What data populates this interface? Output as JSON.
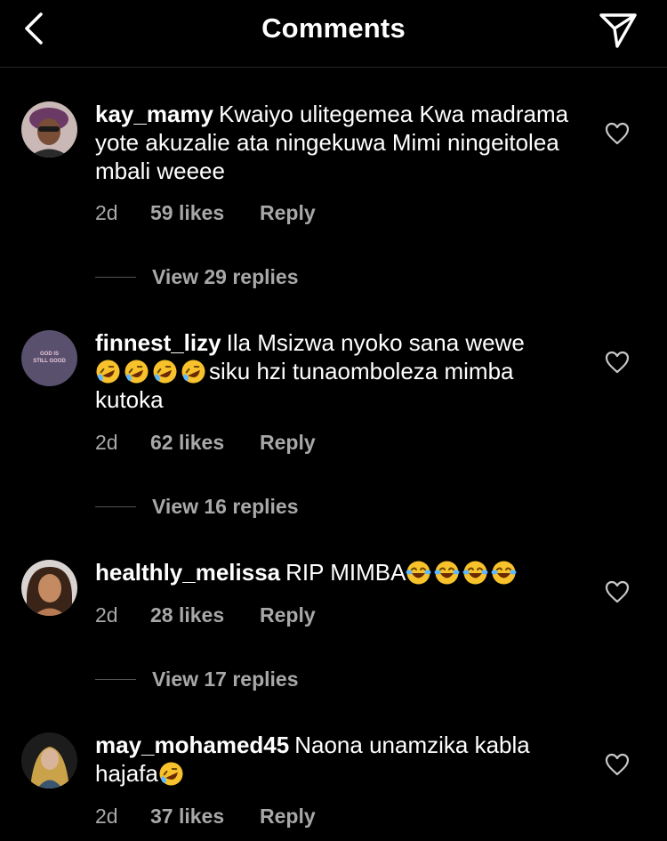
{
  "header": {
    "title": "Comments",
    "back_icon": "chevron-left-icon",
    "send_icon": "paper-plane-icon"
  },
  "colors": {
    "background": "#000000",
    "text": "#ffffff",
    "secondary_text": "#a8a8a8",
    "divider": "#262626"
  },
  "comments": [
    {
      "username": "kay_mamy",
      "text": "Kwaiyo ulitegemea Kwa madrama yote akuzalie ata ningekuwa Mimi ningeitolea mbali weeee",
      "time": "2d",
      "likes": "59 likes",
      "reply": "Reply",
      "view_replies": "View 29 replies"
    },
    {
      "username": "finnest_lizy",
      "text_before": "Ila Msizwa nyoko sana wewe",
      "emoji": "rolling-on-floor-laughing",
      "emoji_count": 4,
      "text_after": "siku hzi tunaomboleza mimba kutoka",
      "avatar_text": "GOD IS STILL GOOD",
      "time": "2d",
      "likes": "62 likes",
      "reply": "Reply",
      "view_replies": "View 16 replies"
    },
    {
      "username": "healthly_melissa",
      "text_before": "RIP MIMBA",
      "emoji": "face-with-tears-of-joy",
      "emoji_count": 4,
      "time": "2d",
      "likes": "28 likes",
      "reply": "Reply",
      "view_replies": "View 17 replies"
    },
    {
      "username": "may_mohamed45",
      "text_before": "Naona unamzika kabla hajafa",
      "emoji": "rolling-on-floor-laughing",
      "emoji_count": 1,
      "time": "2d",
      "likes": "37 likes",
      "reply": "Reply"
    }
  ]
}
